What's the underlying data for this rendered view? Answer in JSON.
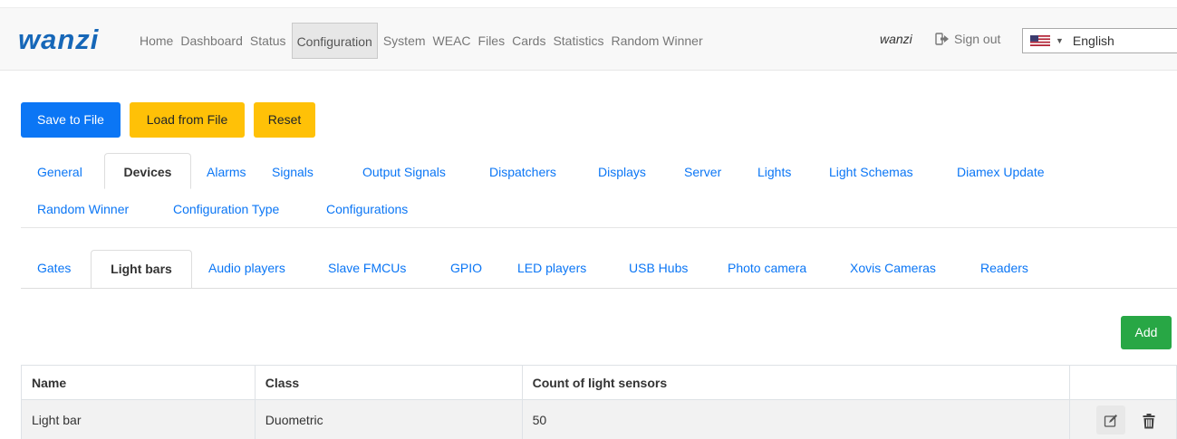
{
  "header": {
    "logo": "wanzi",
    "nav": [
      "Home",
      "Dashboard",
      "Status",
      "Configuration",
      "System",
      "WEAC",
      "Files",
      "Cards",
      "Statistics",
      "Random Winner"
    ],
    "active_nav": "Configuration",
    "user": "wanzi",
    "signout": "Sign out",
    "language": "English"
  },
  "actions": {
    "save": "Save to File",
    "load": "Load from File",
    "reset": "Reset"
  },
  "config_tabs": {
    "row1": [
      "General",
      "Devices",
      "Alarms",
      "Signals",
      "Output Signals",
      "Dispatchers",
      "Displays",
      "Server",
      "Lights",
      "Light Schemas",
      "Diamex Update"
    ],
    "row2": [
      "Random Winner",
      "Configuration Type",
      "Configurations"
    ],
    "active": "Devices"
  },
  "device_tabs": {
    "items": [
      "Gates",
      "Light bars",
      "Audio players",
      "Slave FMCUs",
      "GPIO",
      "LED players",
      "USB Hubs",
      "Photo camera",
      "Xovis Cameras",
      "Readers"
    ],
    "active": "Light bars"
  },
  "add_label": "Add",
  "table": {
    "headers": [
      "Name",
      "Class",
      "Count of light sensors",
      ""
    ],
    "rows": [
      {
        "name": "Light bar",
        "class": "Duometric",
        "count": "50"
      }
    ]
  },
  "icons": {
    "signout": "sign-out-icon",
    "flag": "us-flag-icon",
    "edit": "edit-icon",
    "delete": "trash-icon"
  },
  "colors": {
    "primary": "#0b76f5",
    "warning": "#ffc107",
    "success": "#28a745",
    "logo": "#1667b8"
  }
}
